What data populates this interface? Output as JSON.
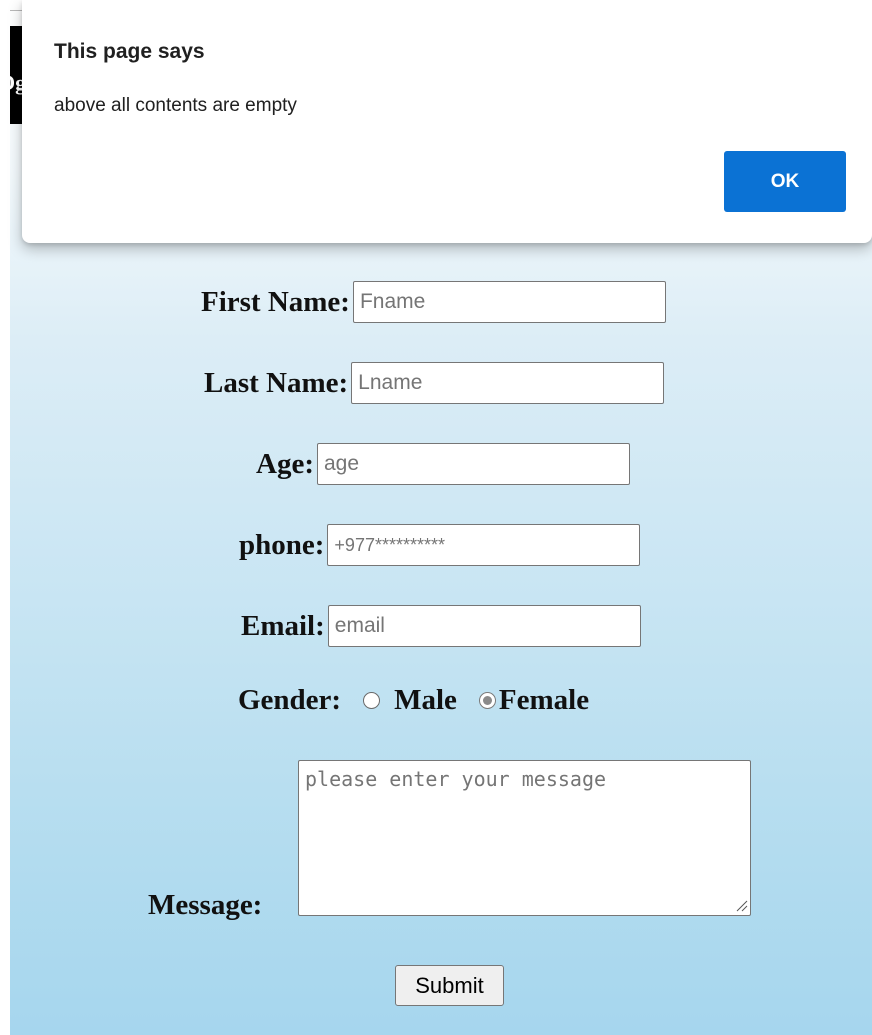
{
  "dialog": {
    "title": "This page says",
    "message": "above all contents are empty",
    "ok_label": "OK"
  },
  "form": {
    "first_name": {
      "label": "First Name:",
      "placeholder": "Fname"
    },
    "last_name": {
      "label": "Last Name:",
      "placeholder": "Lname"
    },
    "age": {
      "label": "Age:",
      "placeholder": "age"
    },
    "phone": {
      "label": "phone:",
      "placeholder": "+977**********"
    },
    "email": {
      "label": "Email:",
      "placeholder": "email"
    },
    "gender": {
      "label": "Gender:",
      "options": [
        {
          "label": "Male",
          "checked": false
        },
        {
          "label": "Female",
          "checked": true
        }
      ]
    },
    "message": {
      "label": "Message:",
      "placeholder": "please enter your message"
    },
    "submit_label": "Submit"
  }
}
